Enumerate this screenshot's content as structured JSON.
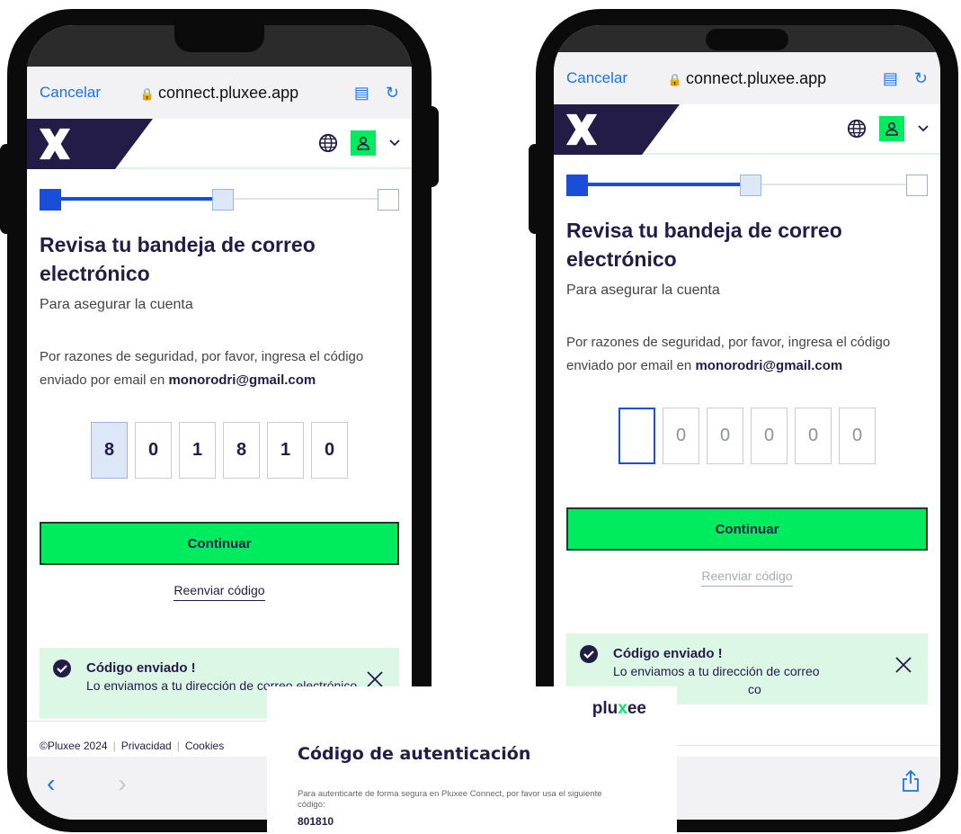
{
  "browser": {
    "cancel_label": "Cancelar",
    "url": "connect.pluxee.app",
    "lock_icon": "lock-icon",
    "reader_icon": "reader-icon",
    "reload_icon": "reload-icon"
  },
  "app": {
    "logo": "pluxee-x-logo",
    "globe_icon": "globe-icon",
    "user_icon": "user-icon",
    "chevron_icon": "chevron-down-icon",
    "accent": "#00eb5e",
    "navy": "#221c46",
    "blue": "#1b4ed8"
  },
  "stepper": {
    "current_step": 2,
    "total_steps": 3
  },
  "page": {
    "title": "Revisa tu bandeja de correo electrónico",
    "subtitle": "Para asegurar la cuenta",
    "notice_prefix": "Por razones de seguridad, por favor, ingresa el código enviado por email en",
    "email": "monorodri@gmail.com"
  },
  "left_phone": {
    "digits": [
      "8",
      "0",
      "1",
      "8",
      "1",
      "0"
    ]
  },
  "right_phone": {
    "placeholder_digits": [
      "",
      "0",
      "0",
      "0",
      "0",
      "0"
    ]
  },
  "continue_label": "Continuar",
  "resend_label": "Reenviar código",
  "toast": {
    "title": "Código enviado !",
    "message": "Lo enviamos a tu dirección de correo electrónico",
    "message_right_partial": "Lo enviamos a tu dirección de correo",
    "message_right_tail": "co"
  },
  "footer": {
    "copyright": "©Pluxee 2024",
    "privacy": "Privacidad",
    "privacy_partial": "acidad",
    "cookies": "Cookies"
  },
  "email_card": {
    "brand_pre": "plu",
    "brand_x": "x",
    "brand_post": "ee",
    "title": "Código de autenticación",
    "text": "Para autenticarte de forma segura en Pluxee Connect, por favor usa el siguiente código:",
    "code": "801810"
  }
}
